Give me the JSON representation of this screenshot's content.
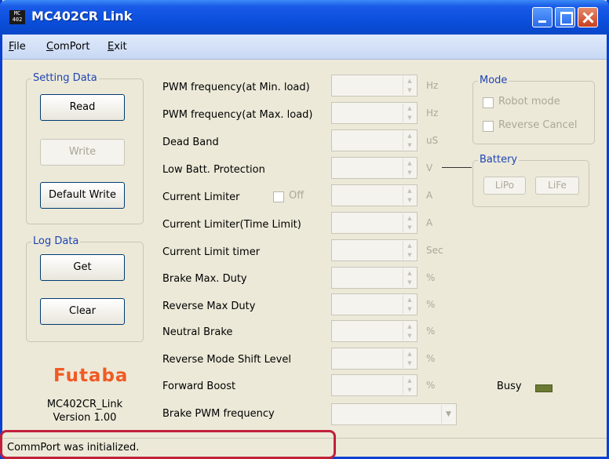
{
  "window": {
    "title": "MC402CR Link",
    "icon_text": "MC 402"
  },
  "menu": [
    "File",
    "ComPort",
    "Exit"
  ],
  "setting_data": {
    "label": "Setting Data",
    "read": "Read",
    "write": "Write",
    "default_write": "Default Write"
  },
  "log_data": {
    "label": "Log Data",
    "get": "Get",
    "clear": "Clear"
  },
  "fields": [
    {
      "label": "PWM frequency(at Min. load)",
      "unit": "Hz"
    },
    {
      "label": "PWM frequency(at Max. load)",
      "unit": "Hz"
    },
    {
      "label": "Dead Band",
      "unit": "uS"
    },
    {
      "label": "Low Batt. Protection",
      "unit": "V"
    },
    {
      "label": "Current Limiter",
      "unit": "A"
    },
    {
      "label": "Current Limiter(Time Limit)",
      "unit": "A"
    },
    {
      "label": "Current Limit timer",
      "unit": "Sec"
    },
    {
      "label": "Brake Max. Duty",
      "unit": "%"
    },
    {
      "label": "Reverse Max Duty",
      "unit": "%"
    },
    {
      "label": "Neutral Brake",
      "unit": "%"
    },
    {
      "label": "Reverse Mode Shift Level",
      "unit": "%"
    },
    {
      "label": "Forward Boost",
      "unit": "%"
    },
    {
      "label": "Brake PWM frequency",
      "unit": ""
    }
  ],
  "current_limiter_off": "Off",
  "mode": {
    "label": "Mode",
    "robot": "Robot mode",
    "reverse_cancel": "Reverse Cancel"
  },
  "battery": {
    "label": "Battery",
    "lipo": "LiPo",
    "life": "LiFe"
  },
  "logo": "Futaba",
  "app_name": "MC402CR_Link",
  "version": "Version 1.00",
  "busy": "Busy",
  "status": "CommPort was initialized."
}
